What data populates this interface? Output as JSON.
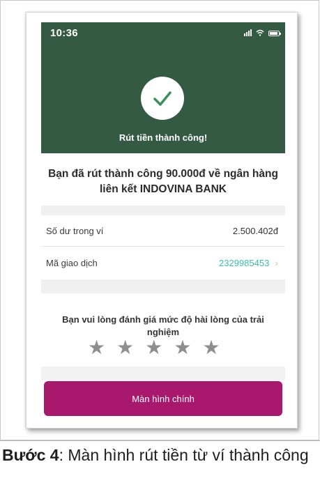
{
  "status_bar": {
    "time": "10:36"
  },
  "success": {
    "title": "Rút tiền thành công!",
    "message_line1": "Bạn đã rút thành công 90.000đ về ngân hàng",
    "message_line2": "liên kết INDOVINA BANK"
  },
  "details": [
    {
      "label": "Số dư trong ví",
      "value": "2.500.402đ"
    },
    {
      "label": "Mã giao dịch",
      "value": "2329985453"
    }
  ],
  "rating": {
    "prompt_line1": "Bạn vui lòng đánh giá mức độ hài lòng của trải",
    "prompt_line2": "nghiệm",
    "stars": 5,
    "selected": 0
  },
  "main_button_label": "Màn hình chính",
  "caption": {
    "bold": "Bước 4",
    "text": ": Màn hình rút tiền từ ví thành công"
  },
  "colors": {
    "header_bg": "#345a43",
    "check": "#3a8f5c",
    "link": "#3cc0a6",
    "button_bg": "#a8196e",
    "star": "#8e8e8e"
  }
}
